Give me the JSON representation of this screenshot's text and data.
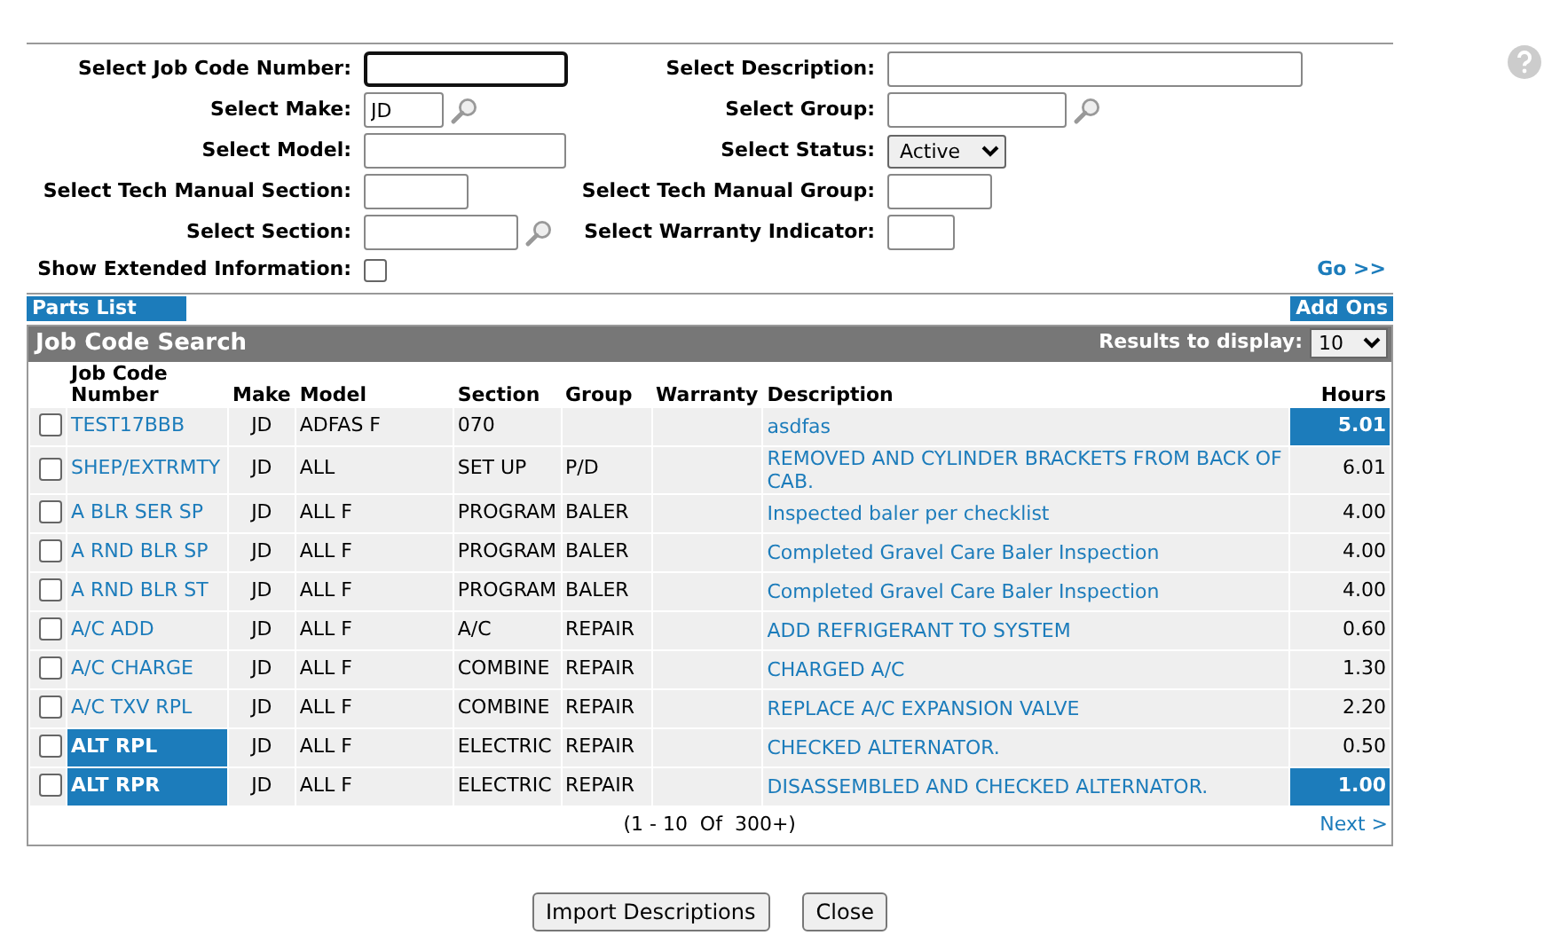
{
  "filters_left": [
    {
      "label": "Select Job Code Number:",
      "kind": "text",
      "focused": true
    },
    {
      "label": "Select Make:",
      "kind": "lookup",
      "value": "JD"
    },
    {
      "label": "Select Model:",
      "kind": "text"
    },
    {
      "label": "Select Tech Manual Section:",
      "kind": "text"
    },
    {
      "label": "Select Section:",
      "kind": "lookup"
    }
  ],
  "filters_right": [
    {
      "label": "Select Description:",
      "kind": "text"
    },
    {
      "label": "Select Group:",
      "kind": "lookup"
    },
    {
      "label": "Select Status:",
      "kind": "select",
      "value": "Active"
    },
    {
      "label": "Select Tech Manual Group:",
      "kind": "text"
    },
    {
      "label": "Select Warranty Indicator:",
      "kind": "text"
    }
  ],
  "extended": {
    "label": "Show Extended Information:",
    "checked": false
  },
  "go_link": "Go >>",
  "tabs": {
    "left": "Parts List",
    "right": "Add Ons"
  },
  "panel": {
    "title": "Job Code Search",
    "results_label": "Results to display:",
    "results_value": "10"
  },
  "columns": [
    "Job Code Number",
    "Make",
    "Model",
    "Section",
    "Group",
    "Warranty",
    "Description",
    "Hours"
  ],
  "rows": [
    {
      "checked": false,
      "code": "TEST17BBB",
      "code_highlighted": false,
      "make": "JD",
      "model": "ADFAS F",
      "section": "070",
      "description": "asdfas",
      "hours": "5.01",
      "hours_highlighted": true
    },
    {
      "checked": false,
      "code": "SHEP/EXTRMTY",
      "code_highlighted": false,
      "make": "JD",
      "model": "ALL",
      "section": "SET UP",
      "group": "P/D",
      "description": "REMOVED AND CYLINDER BRACKETS FROM BACK OF CAB.",
      "hours": "6.01",
      "hours_highlighted": false
    },
    {
      "checked": false,
      "code": "A BLR SER SP",
      "code_highlighted": false,
      "make": "JD",
      "model": "ALL F",
      "section": "PROGRAM",
      "group": "BALER",
      "description": "Inspected baler per checklist",
      "hours": "4.00",
      "hours_highlighted": false
    },
    {
      "checked": false,
      "code": "A RND BLR SP",
      "code_highlighted": false,
      "make": "JD",
      "model": "ALL F",
      "section": "PROGRAM",
      "group": "BALER",
      "description": "Completed Gravel Care Baler Inspection",
      "hours": "4.00",
      "hours_highlighted": false
    },
    {
      "checked": false,
      "code": "A RND BLR ST",
      "code_highlighted": false,
      "make": "JD",
      "model": "ALL F",
      "section": "PROGRAM",
      "group": "BALER",
      "description": "Completed Gravel Care Baler Inspection",
      "hours": "4.00",
      "hours_highlighted": false
    },
    {
      "checked": false,
      "code": "A/C ADD",
      "code_highlighted": false,
      "make": "JD",
      "model": "ALL F",
      "section": "A/C",
      "group": "REPAIR",
      "description": "ADD REFRIGERANT TO SYSTEM",
      "hours": "0.60",
      "hours_highlighted": false
    },
    {
      "checked": false,
      "code": "A/C CHARGE",
      "code_highlighted": false,
      "make": "JD",
      "model": "ALL F",
      "section": "COMBINE",
      "group": "REPAIR",
      "description": "CHARGED A/C",
      "hours": "1.30",
      "hours_highlighted": false
    },
    {
      "checked": false,
      "code": "A/C TXV RPL",
      "code_highlighted": false,
      "make": "JD",
      "model": "ALL F",
      "section": "COMBINE",
      "group": "REPAIR",
      "description": "REPLACE A/C EXPANSION VALVE",
      "hours": "2.20",
      "hours_highlighted": false
    },
    {
      "checked": false,
      "code": "ALT RPL",
      "code_highlighted": true,
      "make": "JD",
      "model": "ALL F",
      "section": "ELECTRIC",
      "group": "REPAIR",
      "description": "CHECKED ALTERNATOR.",
      "hours": "0.50",
      "hours_highlighted": false
    },
    {
      "checked": false,
      "code": "ALT RPR",
      "code_highlighted": true,
      "make": "JD",
      "model": "ALL F",
      "section": "ELECTRIC",
      "group": "REPAIR",
      "description": "DISASSEMBLED AND CHECKED ALTERNATOR.",
      "hours": "1.00",
      "hours_highlighted": true
    }
  ],
  "pagination": "(1 - 10  Of  300+)",
  "next_link": "Next >",
  "buttons": [
    "Import Descriptions",
    "Close"
  ]
}
